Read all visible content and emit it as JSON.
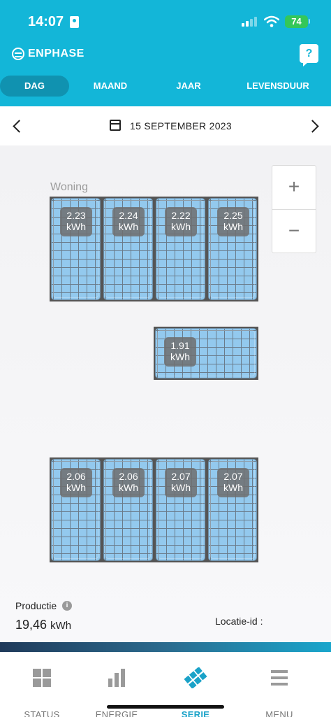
{
  "status_bar": {
    "time": "14:07",
    "battery": "74"
  },
  "brand": {
    "name": "ENPHASE",
    "help_label": "?"
  },
  "tabs": [
    {
      "label": "DAG",
      "active": true
    },
    {
      "label": "MAAND",
      "active": false
    },
    {
      "label": "JAAR",
      "active": false
    },
    {
      "label": "LEVENSDUUR",
      "active": false
    }
  ],
  "date_bar": {
    "date": "15 SEPTEMBER 2023"
  },
  "map": {
    "group_label": "Woning",
    "zoom_in": "+",
    "zoom_out": "−",
    "unit": "kWh",
    "panels_row1": [
      "2.23",
      "2.24",
      "2.22",
      "2.25"
    ],
    "panel_middle": "1.91",
    "panels_row2": [
      "2.06",
      "2.06",
      "2.07",
      "2.07"
    ]
  },
  "stats": {
    "production_label": "Productie",
    "production_value": "19,46",
    "production_unit": "kWh",
    "location_label": "Locatie-id :"
  },
  "bottom_nav": [
    {
      "label": "STATUS",
      "icon": "grid-icon",
      "active": false
    },
    {
      "label": "ENERGIE",
      "icon": "bar-chart-icon",
      "active": false
    },
    {
      "label": "SERIE",
      "icon": "solar-panel-icon",
      "active": true
    },
    {
      "label": "MENU",
      "icon": "menu-icon",
      "active": false
    }
  ],
  "colors": {
    "brand": "#13b6d8",
    "active_nav": "#1aa2c8",
    "panel": "#93c9ee"
  }
}
